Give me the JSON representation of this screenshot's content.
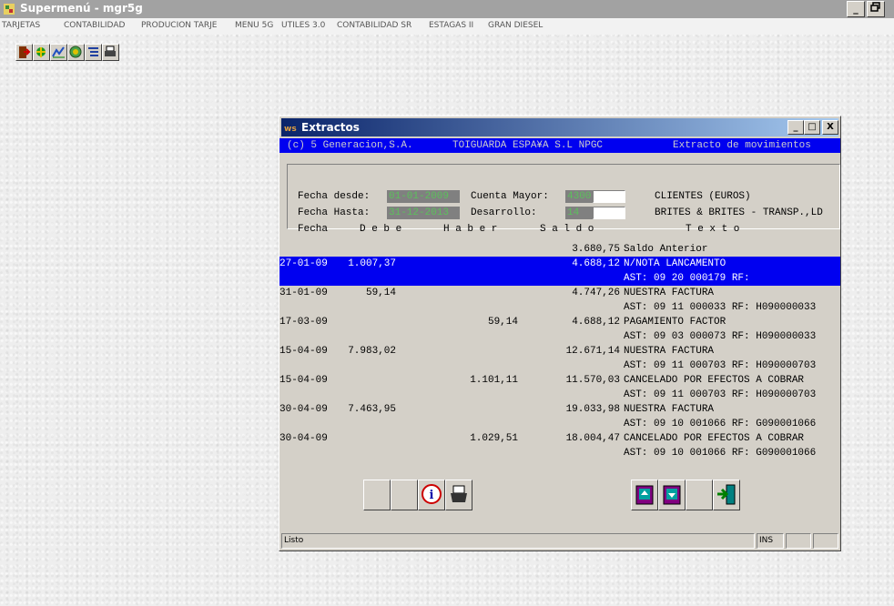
{
  "app": {
    "title": "Supermenú - mgr5g",
    "controls": [
      "_",
      "8"
    ]
  },
  "menu": [
    "TARJETAS",
    "CONTABILIDAD",
    "PRODUCION TARJE",
    "MENU 5G",
    "UTILES 3.0",
    "CONTABILIDAD SR",
    "ESTAGAS II",
    "GRAN DIESEL"
  ],
  "toolbar": [
    "exit-icon",
    "tree-icon",
    "chart-icon",
    "globe-icon",
    "list-icon",
    "print-icon"
  ],
  "window": {
    "title": "Extractos",
    "controls": [
      "_",
      "□",
      "X"
    ],
    "header": {
      "company": "(c) 5 Generacion,S.A.",
      "client": "TOIGUARDA ESPA¥A S.L NPGC",
      "module": "Extracto de movimientos"
    },
    "filters": {
      "fecha_desde_label": "Fecha desde:",
      "fecha_desde": "01-01-2009",
      "fecha_hasta_label": "Fecha Hasta:",
      "fecha_hasta": "31-12-2013",
      "cuenta_mayor_label": "Cuenta Mayor:",
      "cuenta_mayor": "4300",
      "cuenta_mayor_desc": "CLIENTES (EUROS)",
      "desarrollo_label": "Desarrollo:",
      "desarrollo": "14",
      "desarrollo_desc": "BRITES & BRITES - TRANSP.,LD"
    },
    "columns": [
      "Fecha",
      "D e b e",
      "H a b e r",
      "S a l d o",
      "T e x t o"
    ],
    "rows": [
      {
        "fecha": "",
        "debe": "",
        "haber": "",
        "saldo": "3.680,75",
        "texto": "Saldo Anterior",
        "selected": false
      },
      {
        "fecha": "27-01-09",
        "debe": "1.007,37",
        "haber": "",
        "saldo": "4.688,12",
        "texto": "N/NOTA LANCAMENTO",
        "selected": true
      },
      {
        "fecha": "",
        "debe": "",
        "haber": "",
        "saldo": "",
        "texto": "AST: 09 20 000179 RF:",
        "selected": true
      },
      {
        "fecha": "31-01-09",
        "debe": "59,14",
        "haber": "",
        "saldo": "4.747,26",
        "texto": "NUESTRA FACTURA",
        "selected": false
      },
      {
        "fecha": "",
        "debe": "",
        "haber": "",
        "saldo": "",
        "texto": "AST: 09 11 000033 RF: H090000033",
        "selected": false
      },
      {
        "fecha": "17-03-09",
        "debe": "",
        "haber": "59,14",
        "saldo": "4.688,12",
        "texto": "PAGAMIENTO FACTOR",
        "selected": false
      },
      {
        "fecha": "",
        "debe": "",
        "haber": "",
        "saldo": "",
        "texto": "AST: 09 03 000073 RF: H090000033",
        "selected": false
      },
      {
        "fecha": "15-04-09",
        "debe": "7.983,02",
        "haber": "",
        "saldo": "12.671,14",
        "texto": "NUESTRA FACTURA",
        "selected": false
      },
      {
        "fecha": "",
        "debe": "",
        "haber": "",
        "saldo": "",
        "texto": "AST: 09 11 000703 RF: H090000703",
        "selected": false
      },
      {
        "fecha": "15-04-09",
        "debe": "",
        "haber": "1.101,11",
        "saldo": "11.570,03",
        "texto": "CANCELADO POR EFECTOS A COBRAR",
        "selected": false
      },
      {
        "fecha": "",
        "debe": "",
        "haber": "",
        "saldo": "",
        "texto": "AST: 09 11 000703 RF: H090000703",
        "selected": false
      },
      {
        "fecha": "30-04-09",
        "debe": "7.463,95",
        "haber": "",
        "saldo": "19.033,98",
        "texto": "NUESTRA FACTURA",
        "selected": false
      },
      {
        "fecha": "",
        "debe": "",
        "haber": "",
        "saldo": "",
        "texto": "AST: 09 10 001066 RF: G090001066",
        "selected": false
      },
      {
        "fecha": "30-04-09",
        "debe": "",
        "haber": "1.029,51",
        "saldo": "18.004,47",
        "texto": "CANCELADO POR EFECTOS A COBRAR",
        "selected": false
      },
      {
        "fecha": "",
        "debe": "",
        "haber": "",
        "saldo": "",
        "texto": "AST: 09 10 001066 RF: G090001066",
        "selected": false
      }
    ],
    "buttons": [
      "blank-button",
      "blank-button",
      "info-icon",
      "print-icon",
      "page-up-icon",
      "page-down-icon",
      "blank-button",
      "exit-icon"
    ],
    "status": {
      "text": "Listo",
      "ins": "INS"
    }
  },
  "colors": {
    "selection": "#0000f0",
    "field_bg": "#808080",
    "field_text": "#5cc05c",
    "window_title": "#0a246a"
  }
}
